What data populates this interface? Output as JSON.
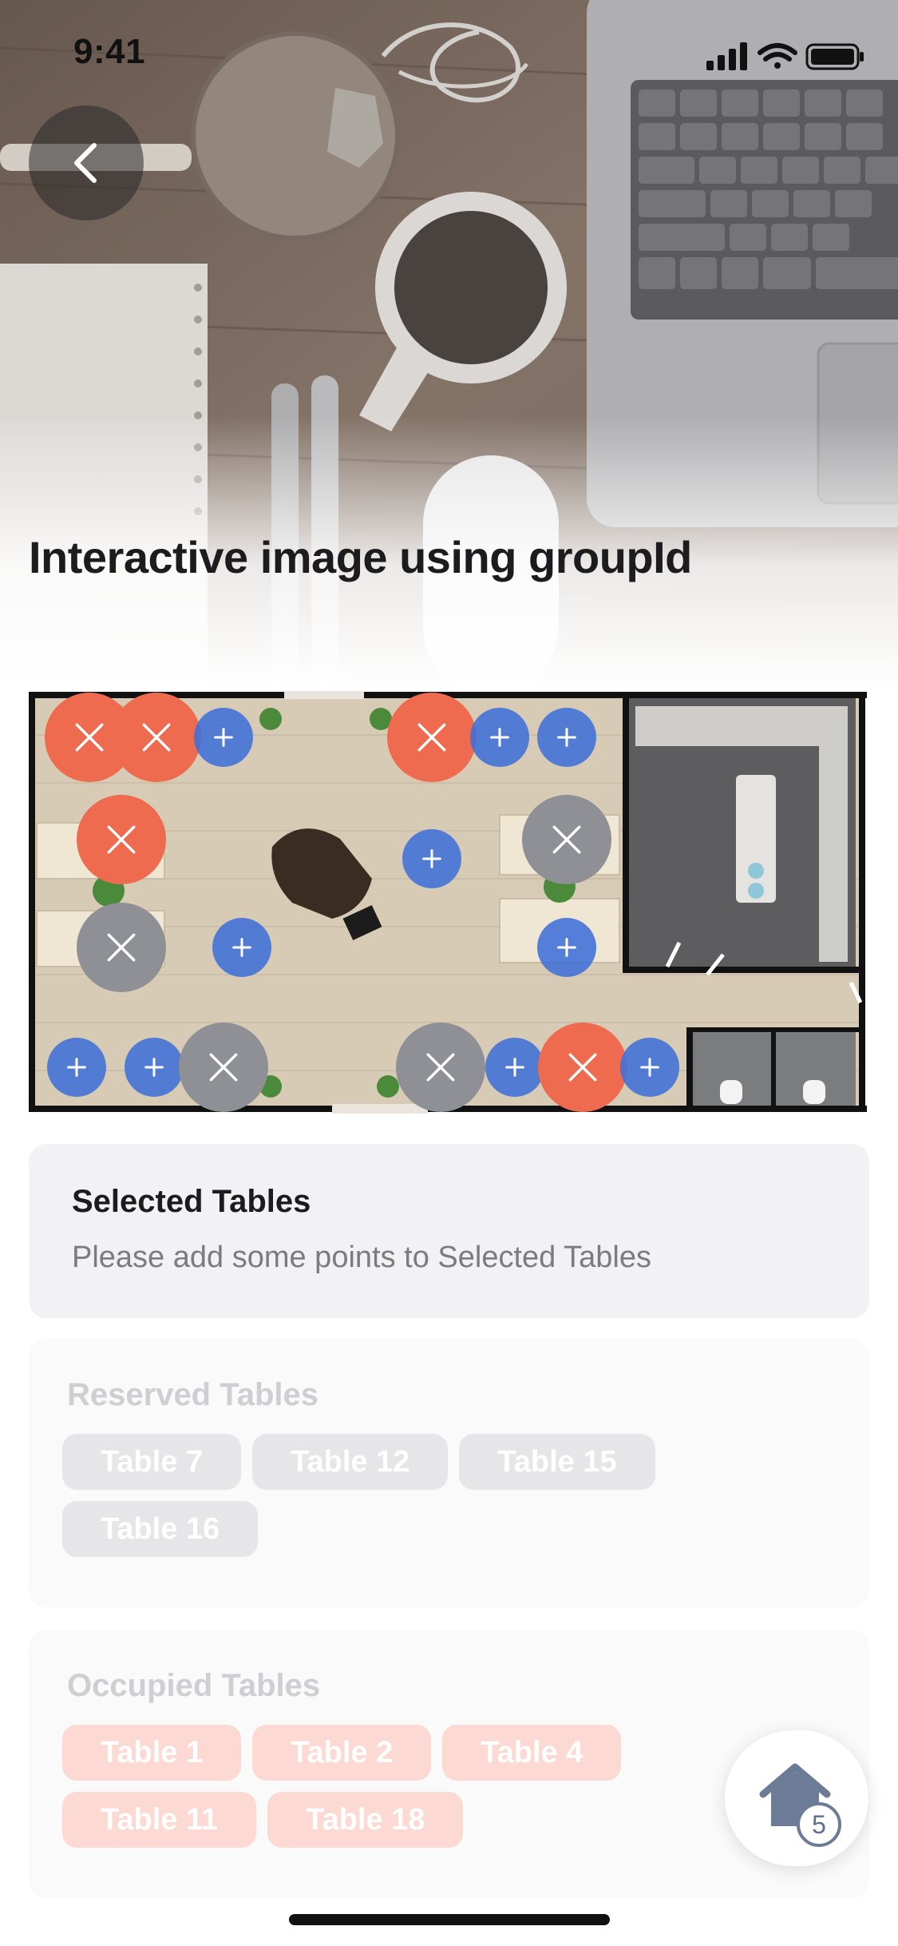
{
  "status_bar": {
    "time": "9:41"
  },
  "header": {
    "back_icon": "chevron-left-icon",
    "title": "Interactive image using groupId"
  },
  "floor_plan": {
    "colors": {
      "available": "#3f6fd8",
      "occupied": "#ef6b4f",
      "reserved": "#8e9096"
    },
    "markers": [
      {
        "state": "occupied",
        "icon": "x"
      },
      {
        "state": "occupied",
        "icon": "x"
      },
      {
        "state": "available",
        "icon": "plus"
      },
      {
        "state": "occupied",
        "icon": "x"
      },
      {
        "state": "available",
        "icon": "plus"
      },
      {
        "state": "available",
        "icon": "plus"
      },
      {
        "state": "occupied",
        "icon": "x"
      },
      {
        "state": "available",
        "icon": "plus"
      },
      {
        "state": "reserved",
        "icon": "x"
      },
      {
        "state": "reserved",
        "icon": "x"
      },
      {
        "state": "available",
        "icon": "plus"
      },
      {
        "state": "available",
        "icon": "plus"
      },
      {
        "state": "available",
        "icon": "plus"
      },
      {
        "state": "available",
        "icon": "plus"
      },
      {
        "state": "reserved",
        "icon": "x"
      },
      {
        "state": "reserved",
        "icon": "x"
      },
      {
        "state": "available",
        "icon": "plus"
      },
      {
        "state": "occupied",
        "icon": "x"
      },
      {
        "state": "available",
        "icon": "plus"
      }
    ]
  },
  "selected": {
    "title": "Selected Tables",
    "empty_message": "Please add some points to Selected Tables"
  },
  "reserved": {
    "title": "Reserved Tables",
    "tables": [
      "Table 7",
      "Table 12",
      "Table 15",
      "Table 16"
    ]
  },
  "occupied": {
    "title": "Occupied Tables",
    "tables": [
      "Table 1",
      "Table 2",
      "Table 4",
      "Table 11",
      "Table 18"
    ]
  },
  "fab": {
    "icon": "home-icon",
    "badge": "5"
  }
}
